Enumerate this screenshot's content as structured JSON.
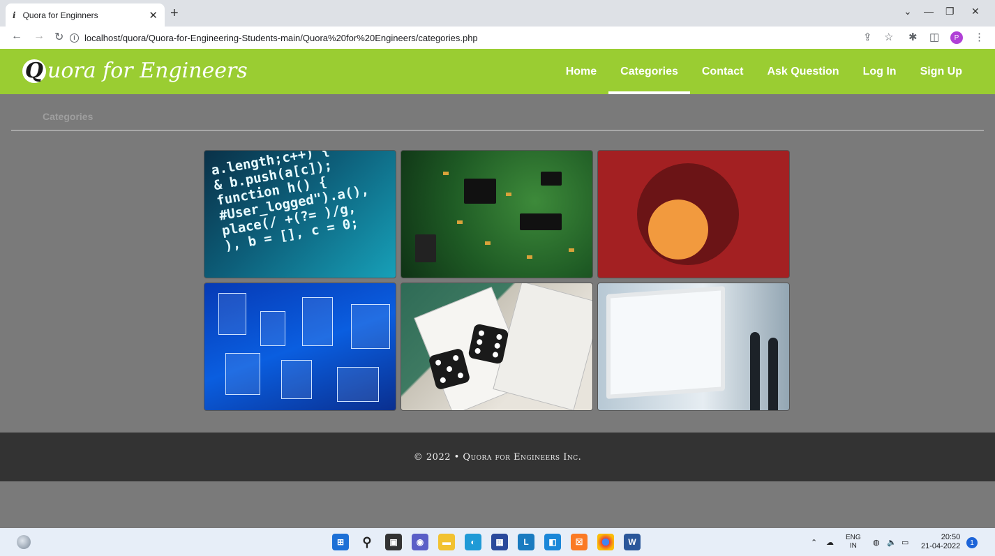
{
  "browser": {
    "tab_title": "Quora for Enginners",
    "tab_favicon": "i",
    "new_tab": "+",
    "url": "localhost/quora/Quora-for-Engineering-Students-main/Quora%20for%20Engineers/categories.php",
    "profile_initial": "P"
  },
  "header": {
    "logo_initial": "Q",
    "logo_rest": "uora for Engineers",
    "nav": {
      "home": "Home",
      "categories": "Categories",
      "contact": "Contact",
      "ask": "Ask Question",
      "login": "Log In",
      "signup": "Sign Up"
    }
  },
  "main": {
    "breadcrumb": "Categories"
  },
  "footer": {
    "text": "© 2022 • Quora for Engineers Inc."
  },
  "taskbar": {
    "lang_top": "ENG",
    "lang_bottom": "IN",
    "time": "20:50",
    "date": "21-04-2022",
    "notifications": "1"
  },
  "code_lines": [
    "a.length;c++) {",
    "& b.push(a[c]);",
    "function h() {",
    "#User_logged\").a(),",
    "place(/ +(?= )/g,",
    "), b = [], c = 0;"
  ]
}
